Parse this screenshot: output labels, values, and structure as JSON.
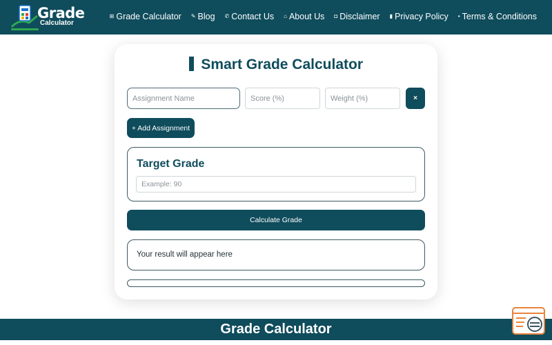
{
  "logo": {
    "word1": "Grade",
    "word2": "Calculator"
  },
  "nav": {
    "items": [
      {
        "label": "Grade Calculator",
        "icon": "calculator-icon",
        "glyph": "⊞"
      },
      {
        "label": "Blog",
        "icon": "blog-icon",
        "glyph": "✎"
      },
      {
        "label": "Contact Us",
        "icon": "phone-icon",
        "glyph": "✆"
      },
      {
        "label": "About Us",
        "icon": "about-icon",
        "glyph": "⌂"
      },
      {
        "label": "Disclaimer",
        "icon": "disclaimer-icon",
        "glyph": "◘"
      },
      {
        "label": "Privacy Policy",
        "icon": "privacy-icon",
        "glyph": "▮"
      },
      {
        "label": "Terms & Conditions",
        "icon": "terms-icon",
        "glyph": "▪"
      }
    ]
  },
  "main": {
    "title": "Smart Grade Calculator",
    "assignment_placeholder": "Assignment Name",
    "score_placeholder": "Score (%)",
    "weight_placeholder": "Weight (%)",
    "remove_label": "×",
    "add_label": "+ Add Assignment",
    "target_title": "Target Grade",
    "target_placeholder": "Example: 90",
    "calculate_label": "Calculate Grade",
    "result_text": "Your result will appear here"
  },
  "footer": {
    "title": "Grade Calculator"
  },
  "colors": {
    "primary": "#0f4c5c",
    "widget_orange": "#e8843c"
  }
}
